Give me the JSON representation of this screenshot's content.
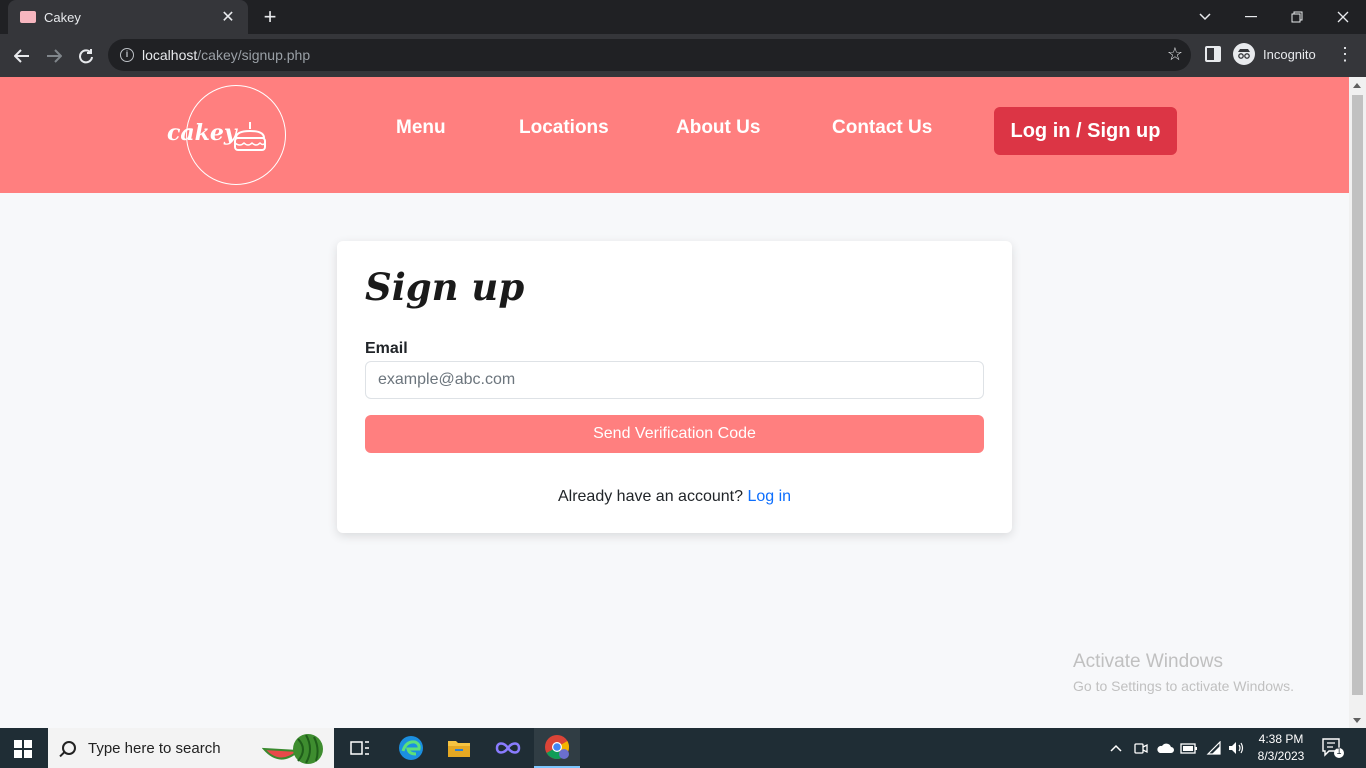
{
  "browser": {
    "tab_title": "Cakey",
    "tab_close": "✕",
    "new_tab": "+",
    "url_host": "localhost",
    "url_path": "/cakey/signup.php",
    "incognito_label": "Incognito"
  },
  "header": {
    "logo_text": "cakey",
    "nav": [
      "Menu",
      "Locations",
      "About Us",
      "Contact Us"
    ],
    "login_button": "Log in / Sign up"
  },
  "signup": {
    "title": "Sign up",
    "email_label": "Email",
    "email_placeholder": "example@abc.com",
    "email_value": "",
    "send_button": "Send Verification Code",
    "already_text": "Already have an account?",
    "login_link": "Log in"
  },
  "watermark": {
    "title": "Activate Windows",
    "subtitle": "Go to Settings to activate Windows."
  },
  "taskbar": {
    "search_placeholder": "Type here to search",
    "time": "4:38 PM",
    "date": "8/3/2023",
    "notification_count": "1"
  },
  "colors": {
    "brand": "#ff7f7f",
    "login_button": "#dc3545",
    "link": "#0d6efd"
  }
}
